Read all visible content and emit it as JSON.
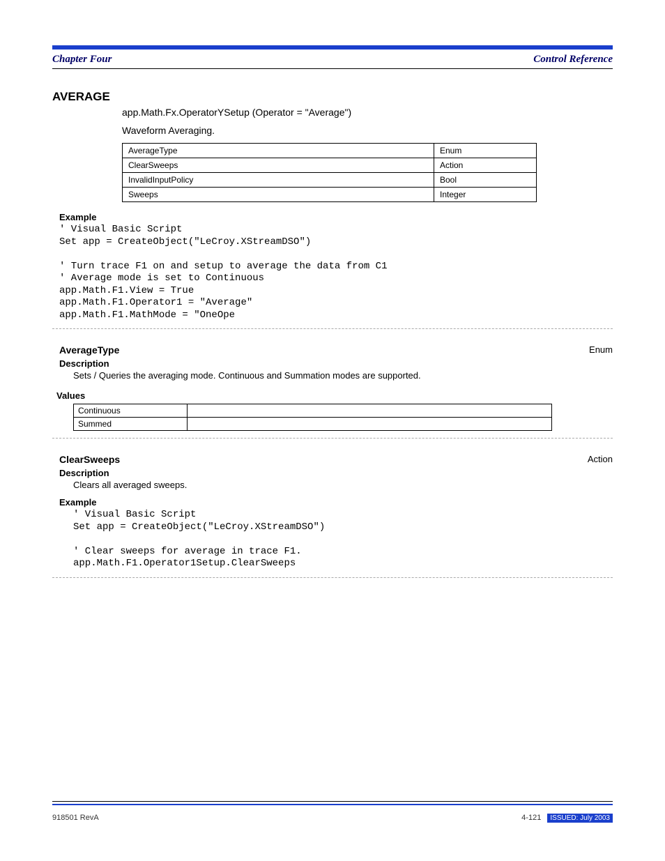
{
  "header": {
    "chapter_left": "Chapter Four",
    "chapter_right": "Control Reference"
  },
  "section": {
    "title": "AVERAGE",
    "subpath": "app.Math.Fx.OperatorYSetup (Operator = \"Average\")",
    "intro": "Waveform Averaging."
  },
  "members": [
    {
      "name": "AverageType",
      "type": "Enum"
    },
    {
      "name": "ClearSweeps",
      "type": "Action"
    },
    {
      "name": "InvalidInputPolicy",
      "type": "Bool"
    },
    {
      "name": "Sweeps",
      "type": "Integer"
    }
  ],
  "example1_label": "Example",
  "example1_code": "' Visual Basic Script\nSet app = CreateObject(\"LeCroy.XStreamDSO\")\n\n' Turn trace F1 on and setup to average the data from C1\n' Average mode is set to Continuous\napp.Math.F1.View = True\napp.Math.F1.Operator1 = \"Average\"\napp.Math.F1.MathMode = \"OneOpe",
  "item1": {
    "name": "AverageType",
    "type": "Enum",
    "desc_heading": "Description",
    "desc_text": "Sets / Queries the averaging mode. Continuous and Summation modes are supported.",
    "values_heading": "Values",
    "values": [
      {
        "a": "Continuous",
        "b": ""
      },
      {
        "a": "Summed",
        "b": ""
      }
    ]
  },
  "item2": {
    "name": "ClearSweeps",
    "type": "Action",
    "desc_heading": "Description",
    "desc_text": "Clears all averaged sweeps.",
    "example_label": "Example",
    "example_code": "' Visual Basic Script\nSet app = CreateObject(\"LeCroy.XStreamDSO\")\n\n' Clear sweeps for average in trace F1.\napp.Math.F1.Operator1Setup.ClearSweeps"
  },
  "footer": {
    "left": "918501 RevA",
    "center": "",
    "right_num": "4-121",
    "right_badge": "ISSUED: July 2003"
  }
}
